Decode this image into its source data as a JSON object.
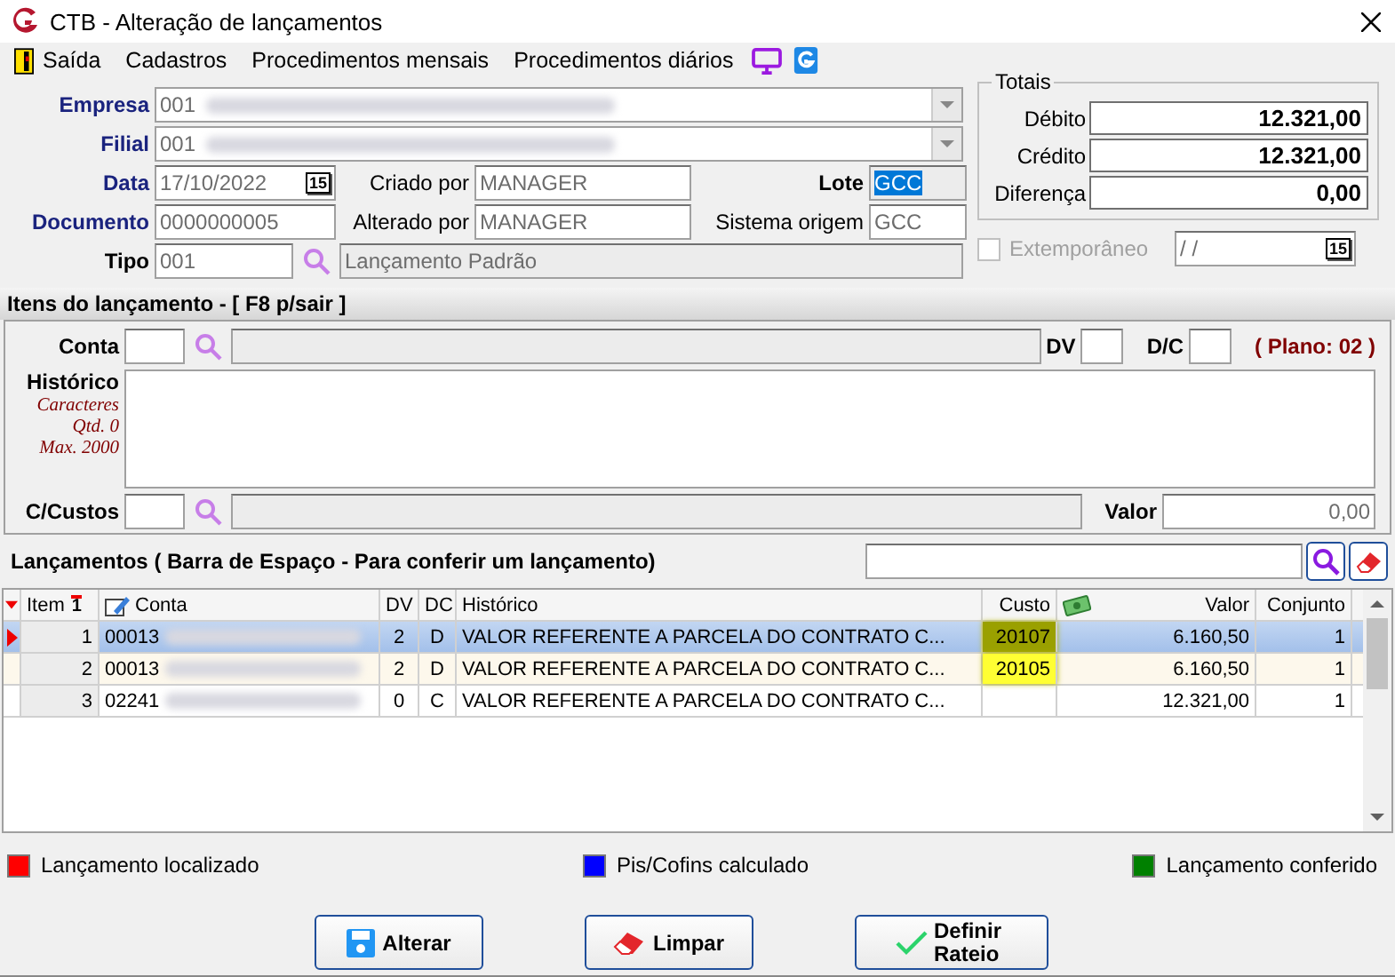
{
  "window": {
    "title": "CTB - Alteração de lançamentos"
  },
  "menu": [
    {
      "label": "Saída",
      "kind": "exit"
    },
    {
      "label": "Cadastros",
      "kind": "text"
    },
    {
      "label": "Procedimentos mensais",
      "kind": "text"
    },
    {
      "label": "Procedimentos diários",
      "kind": "text"
    }
  ],
  "header": {
    "empresa": {
      "label": "Empresa",
      "value": "001"
    },
    "filial": {
      "label": "Filial",
      "value": "001"
    },
    "data": {
      "label": "Data",
      "value": "17/10/2022",
      "calendar_label": "15"
    },
    "criado_por": {
      "label": "Criado por",
      "value": "MANAGER"
    },
    "lote": {
      "label": "Lote",
      "value": "GCC",
      "selected": true
    },
    "documento": {
      "label": "Documento",
      "value": "0000000005"
    },
    "alterado_por": {
      "label": "Alterado por",
      "value": "MANAGER"
    },
    "sistema_origem": {
      "label": "Sistema origem",
      "value": "GCC"
    },
    "tipo": {
      "label": "Tipo",
      "code": "001",
      "description": "Lançamento Padrão"
    }
  },
  "totais": {
    "title": "Totais",
    "rows": [
      {
        "label": "Débito",
        "value": "12.321,00"
      },
      {
        "label": "Crédito",
        "value": "12.321,00"
      },
      {
        "label": "Diferença",
        "value": "0,00"
      }
    ]
  },
  "extemporaneo": {
    "label": "Extemporâneo",
    "checked": false,
    "disabled": true,
    "value": "/ /",
    "calendar_label": "15"
  },
  "itens": {
    "title": "Itens do lançamento - [ F8 p/sair ]",
    "conta_label": "Conta",
    "dv_label": "DV",
    "dc_label": "D/C",
    "plano": "( Plano: 02 )",
    "historico_label": "Histórico",
    "char_info": [
      "Caracteres",
      "Qtd. 0",
      "Max. 2000"
    ],
    "ccustos_label": "C/Custos",
    "valor_label": "Valor",
    "valor": "0,00"
  },
  "lancamentos": {
    "title": "Lançamentos ( Barra de Espaço - Para conferir um lançamento)",
    "sort_order": "1",
    "columns": [
      "Item",
      "Conta",
      "DV",
      "DC",
      "Histórico",
      "Custo",
      "Valor",
      "Conjunto"
    ],
    "rows": [
      {
        "item": "1",
        "conta": "00013",
        "dv": "2",
        "dc": "D",
        "historico": "VALOR REFERENTE A PARCELA DO CONTRATO C...",
        "custo": "20107",
        "custo_highlighted": true,
        "valor": "6.160,50",
        "conjunto": "1",
        "selected": true,
        "current": true,
        "tinted": false
      },
      {
        "item": "2",
        "conta": "00013",
        "dv": "2",
        "dc": "D",
        "historico": "VALOR REFERENTE A PARCELA DO CONTRATO C...",
        "custo": "20105",
        "custo_highlighted": true,
        "valor": "6.160,50",
        "conjunto": "1",
        "selected": false,
        "current": false,
        "tinted": true
      },
      {
        "item": "3",
        "conta": "02241",
        "dv": "0",
        "dc": "C",
        "historico": "VALOR REFERENTE A PARCELA DO CONTRATO C...",
        "custo": "",
        "custo_highlighted": false,
        "valor": "12.321,00",
        "conjunto": "1",
        "selected": false,
        "current": false,
        "tinted": false
      }
    ]
  },
  "legend": [
    {
      "label": "Lançamento localizado",
      "color": "#ff0000"
    },
    {
      "label": "Pis/Cofins calculado",
      "color": "#0000ff"
    },
    {
      "label": "Lançamento conferido",
      "color": "#008000"
    }
  ],
  "buttons": [
    {
      "label": "Alterar",
      "kind": "save"
    },
    {
      "label": "Limpar",
      "kind": "clear"
    },
    {
      "label": "Definir Rateio",
      "kind": "confirm"
    }
  ]
}
